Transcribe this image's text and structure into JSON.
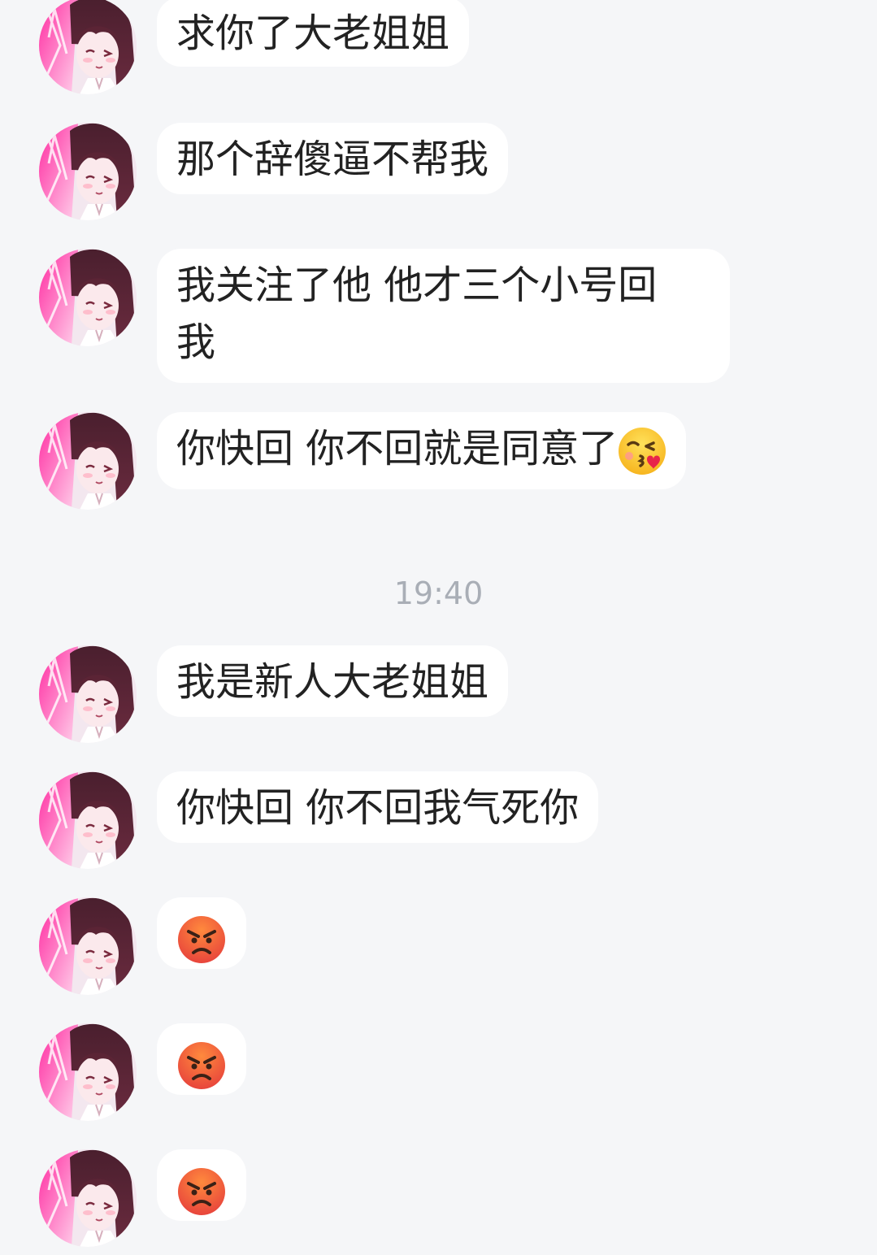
{
  "timestamp": "19:40",
  "messages": [
    {
      "text": "求你了大老姐姐"
    },
    {
      "text": "那个辞傻逼不帮我"
    },
    {
      "line1": "我关注了他 他才三个小号回",
      "line2": "我"
    },
    {
      "text": "你快回 你不回就是同意了",
      "emoji": "kissing-face-heart-emoji"
    },
    {
      "text": "我是新人大老姐姐"
    },
    {
      "text": "你快回 你不回我气死你"
    },
    {
      "emoji": "angry-face-emoji"
    },
    {
      "emoji": "angry-face-emoji"
    },
    {
      "emoji": "angry-face-emoji"
    }
  ],
  "colors": {
    "background": "#f5f6f8",
    "bubble": "#ffffff",
    "text": "#222222",
    "timestamp": "#a9aeb6"
  }
}
